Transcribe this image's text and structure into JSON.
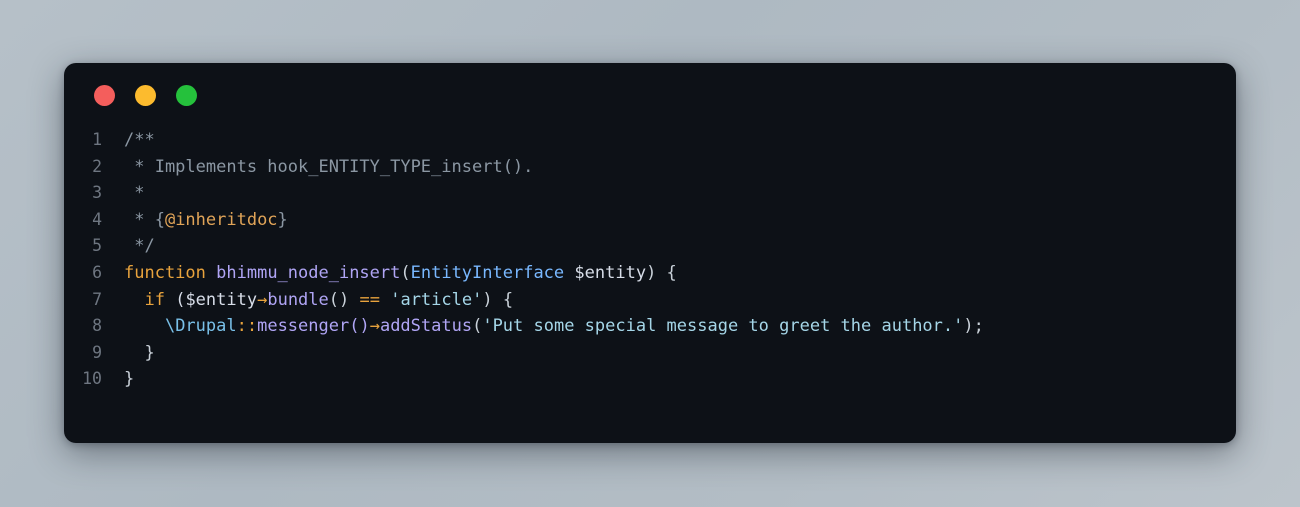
{
  "window": {
    "title": "",
    "controls": [
      {
        "name": "close",
        "color": "#f45e5c",
        "label": ""
      },
      {
        "name": "minimize",
        "color": "#fcbb2e",
        "label": ""
      },
      {
        "name": "maximize",
        "color": "#25c13c",
        "label": ""
      }
    ]
  },
  "editor": {
    "language": "php",
    "line_numbers": [
      "1",
      "2",
      "3",
      "4",
      "5",
      "6",
      "7",
      "8",
      "9",
      "10"
    ],
    "lines": [
      {
        "n": "1",
        "text": "/**"
      },
      {
        "n": "2",
        "text": " * Implements hook_ENTITY_TYPE_insert()."
      },
      {
        "n": "3",
        "text": " *"
      },
      {
        "n": "4",
        "text": " * {@inheritdoc}"
      },
      {
        "n": "5",
        "text": " */"
      },
      {
        "n": "6",
        "text": "function bhimmu_node_insert(EntityInterface $entity) {"
      },
      {
        "n": "7",
        "text": "  if ($entity->bundle() == 'article') {"
      },
      {
        "n": "8",
        "text": "    \\Drupal::messenger()->addStatus('Put some special message to greet the author.');"
      },
      {
        "n": "9",
        "text": "  }"
      },
      {
        "n": "10",
        "text": "}"
      }
    ],
    "tokens": {
      "l1": [
        {
          "t": "/**",
          "c": "t-comment"
        }
      ],
      "l2": [
        {
          "t": " * Implements hook_ENTITY_TYPE_insert().",
          "c": "t-comment"
        }
      ],
      "l3": [
        {
          "t": " *",
          "c": "t-comment"
        }
      ],
      "l4_a": " * {",
      "l4_b": "@inheritdoc",
      "l4_c": "}",
      "l5": " */",
      "l6_a": "function",
      "l6_b": " ",
      "l6_c": "bhimmu_node_insert",
      "l6_d": "(",
      "l6_e": "EntityInterface",
      "l6_f": " ",
      "l6_g": "$entity",
      "l6_h": ") {",
      "l7_a": "  ",
      "l7_b": "if",
      "l7_c": " ($entity",
      "l7_d": "→",
      "l7_e": "bundle",
      "l7_f": "() ",
      "l7_g": "==",
      "l7_h": " ",
      "l7_i": "'article'",
      "l7_j": ") {",
      "l8_a": "    ",
      "l8_b": "\\Drupal",
      "l8_c": "::",
      "l8_d": "messenger",
      "l8_e": "()",
      "l8_f": "→",
      "l8_g": "addStatus",
      "l8_h": "(",
      "l8_i": "'Put some special message to greet the author.'",
      "l8_j": ");",
      "l9": "  }",
      "l10": "}"
    }
  },
  "colors": {
    "page_background": "#b4bec6",
    "window_background": "#0d1117",
    "line_number": "#6e7681",
    "default_text": "#c9d1d9",
    "comment": "#8b97a3",
    "doc_tag": "#e0a458",
    "keyword": "#e8a33d",
    "function_name": "#b0a5f5",
    "type_name": "#79b8ff",
    "operator": "#e8a33d",
    "string": "#a5d6e8",
    "namespace": "#79c0e8"
  }
}
